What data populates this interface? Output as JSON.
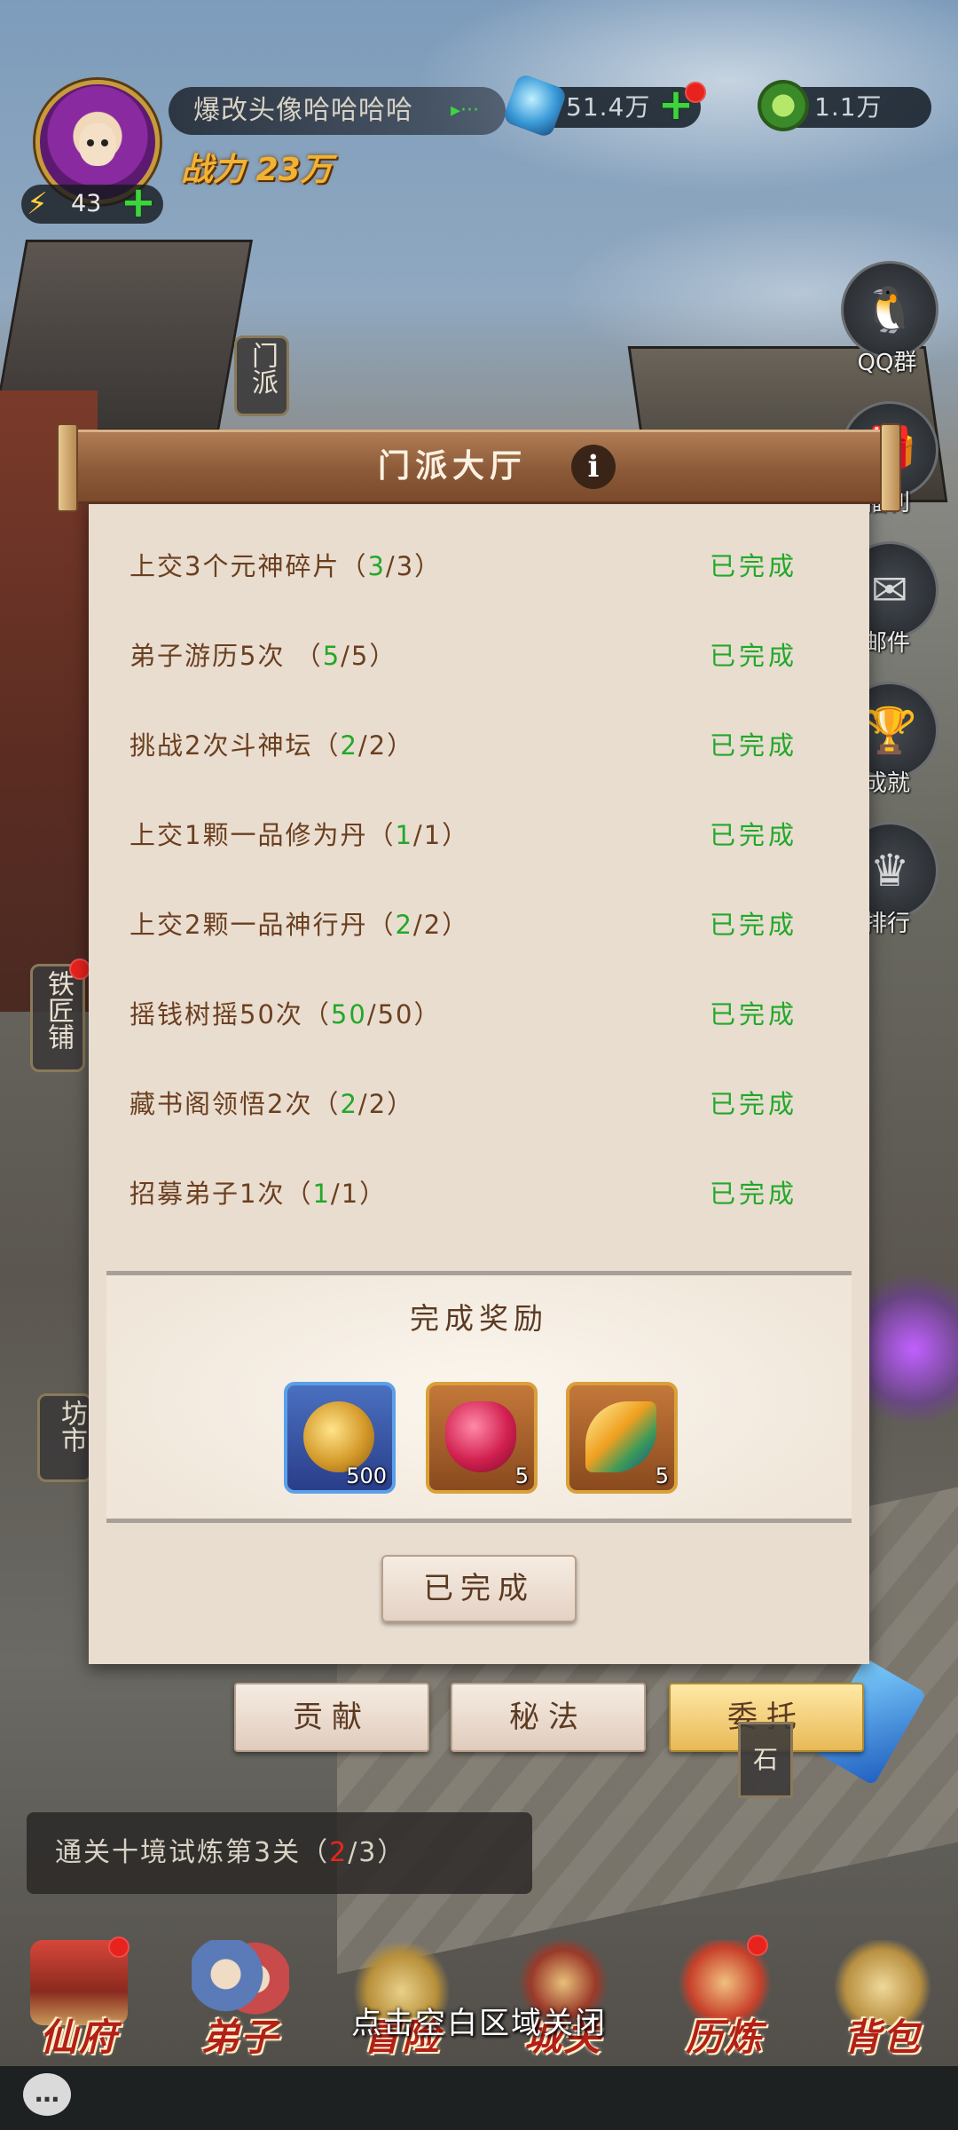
{
  "hud": {
    "player_name": "爆改头像哈哈哈哈",
    "power_label": "战力",
    "power_value": "23万",
    "energy": "43",
    "currency_gem": "51.4万",
    "currency_jade": "1.1万"
  },
  "side_buttons": [
    {
      "label": "QQ群",
      "icon": "qq-penguin-icon"
    },
    {
      "label": "福利",
      "icon": "gift-icon"
    },
    {
      "label": "邮件",
      "icon": "mail-icon"
    },
    {
      "label": "成就",
      "icon": "trophy-icon"
    },
    {
      "label": "排行",
      "icon": "crown-icon"
    }
  ],
  "buildings": {
    "sect_sign": "门派",
    "smithy_sign": "铁匠铺",
    "market_sign": "坊市",
    "stone_sign": "石"
  },
  "dialog": {
    "title": "门派大厅",
    "status_done": "已完成",
    "tasks": [
      {
        "name": "上交3个元神碎片",
        "done": "3",
        "total": "3",
        "status": "已完成"
      },
      {
        "name": "弟子游历5次 ",
        "done": "5",
        "total": "5",
        "status": "已完成"
      },
      {
        "name": "挑战2次斗神坛",
        "done": "2",
        "total": "2",
        "status": "已完成"
      },
      {
        "name": "上交1颗一品修为丹",
        "done": "1",
        "total": "1",
        "status": "已完成"
      },
      {
        "name": "上交2颗一品神行丹",
        "done": "2",
        "total": "2",
        "status": "已完成"
      },
      {
        "name": "摇钱树摇50次",
        "done": "50",
        "total": "50",
        "status": "已完成"
      },
      {
        "name": "藏书阁领悟2次",
        "done": "2",
        "total": "2",
        "status": "已完成"
      },
      {
        "name": "招募弟子1次",
        "done": "1",
        "total": "1",
        "status": "已完成"
      }
    ],
    "reward_title": "完成奖励",
    "rewards": [
      {
        "icon": "gold-coin-icon",
        "count": "500"
      },
      {
        "icon": "red-gem-icon",
        "count": "5"
      },
      {
        "icon": "phoenix-feather-icon",
        "count": "5"
      }
    ],
    "button_label": "已完成"
  },
  "tabs": [
    {
      "label": "贡献",
      "active": false
    },
    {
      "label": "秘法",
      "active": false
    },
    {
      "label": "委托",
      "active": true
    }
  ],
  "quest": {
    "text": "通关十境试炼第3关",
    "progress_done": "2",
    "progress_total": "3"
  },
  "nav": [
    {
      "label": "仙府",
      "badge": true
    },
    {
      "label": "弟子",
      "badge": false
    },
    {
      "label": "冒险",
      "badge": false
    },
    {
      "label": "城关",
      "badge": false
    },
    {
      "label": "历炼",
      "badge": true
    },
    {
      "label": "背包",
      "badge": false
    }
  ],
  "close_hint": "点击空白区域关闭",
  "colors": {
    "done_green": "#22a82a",
    "title_brown": "#8c5a38",
    "active_tab": "#e8b956",
    "badge_red": "#e8221c"
  }
}
